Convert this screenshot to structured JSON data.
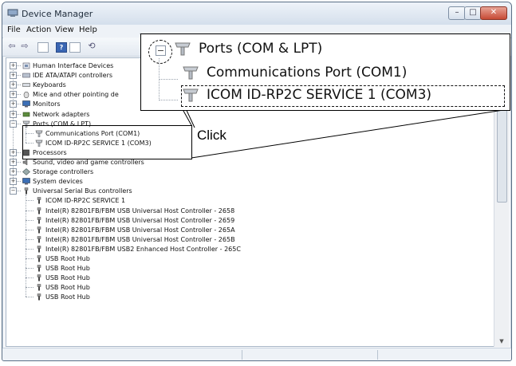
{
  "window": {
    "title": "Device Manager",
    "min_glyph": "–",
    "max_glyph": "□",
    "close_glyph": "✕"
  },
  "menu": {
    "file": "File",
    "action": "Action",
    "view": "View",
    "help": "Help"
  },
  "tree": [
    {
      "label": "Human Interface Devices",
      "expander": "+",
      "icon": "hid-icon"
    },
    {
      "label": "IDE ATA/ATAPI controllers",
      "expander": "+",
      "icon": "ide-controller-icon"
    },
    {
      "label": "Keyboards",
      "expander": "+",
      "icon": "keyboard-icon"
    },
    {
      "label": "Mice and other pointing de",
      "expander": "+",
      "icon": "mouse-icon"
    },
    {
      "label": "Monitors",
      "expander": "+",
      "icon": "monitor-icon"
    },
    {
      "label": "Network adapters",
      "expander": "+",
      "icon": "network-adapter-icon"
    },
    {
      "label": "Ports (COM & LPT)",
      "expander": "−",
      "icon": "port-icon"
    },
    {
      "label": "Communications Port (COM1)",
      "child": true,
      "icon": "port-icon"
    },
    {
      "label": "ICOM ID-RP2C SERVICE 1 (COM3)",
      "child": true,
      "icon": "port-icon"
    },
    {
      "label": "Processors",
      "expander": "+",
      "icon": "processor-icon"
    },
    {
      "label": "Sound, video and game controllers",
      "expander": "+",
      "icon": "sound-icon"
    },
    {
      "label": "Storage controllers",
      "expander": "+",
      "icon": "storage-icon"
    },
    {
      "label": "System devices",
      "expander": "+",
      "icon": "system-device-icon"
    },
    {
      "label": "Universal Serial Bus controllers",
      "expander": "−",
      "icon": "usb-icon"
    },
    {
      "label": "ICOM ID-RP2C SERVICE 1",
      "child": true,
      "icon": "usb-icon"
    },
    {
      "label": "Intel(R) 82801FB/FBM USB Universal Host Controller - 2658",
      "child": true,
      "icon": "usb-icon"
    },
    {
      "label": "Intel(R) 82801FB/FBM USB Universal Host Controller - 2659",
      "child": true,
      "icon": "usb-icon"
    },
    {
      "label": "Intel(R) 82801FB/FBM USB Universal Host Controller - 265A",
      "child": true,
      "icon": "usb-icon"
    },
    {
      "label": "Intel(R) 82801FB/FBM USB Universal Host Controller - 265B",
      "child": true,
      "icon": "usb-icon"
    },
    {
      "label": "Intel(R) 82801FB/FBM USB2 Enhanced Host Controller - 265C",
      "child": true,
      "icon": "usb-icon"
    },
    {
      "label": "USB Root Hub",
      "child": true,
      "icon": "usb-icon"
    },
    {
      "label": "USB Root Hub",
      "child": true,
      "icon": "usb-icon"
    },
    {
      "label": "USB Root Hub",
      "child": true,
      "icon": "usb-icon"
    },
    {
      "label": "USB Root Hub",
      "child": true,
      "icon": "usb-icon"
    },
    {
      "label": "USB Root Hub",
      "child": true,
      "icon": "usb-icon"
    }
  ],
  "callout": {
    "expander": "−",
    "ports_label": "Ports (COM & LPT)",
    "com1_label": "Communications Port (COM1)",
    "com3_label": "ICOM ID-RP2C SERVICE 1 (COM3)",
    "click_label": "Click"
  },
  "colors": {
    "accent": "#3a66b3",
    "close": "#c74a35"
  }
}
